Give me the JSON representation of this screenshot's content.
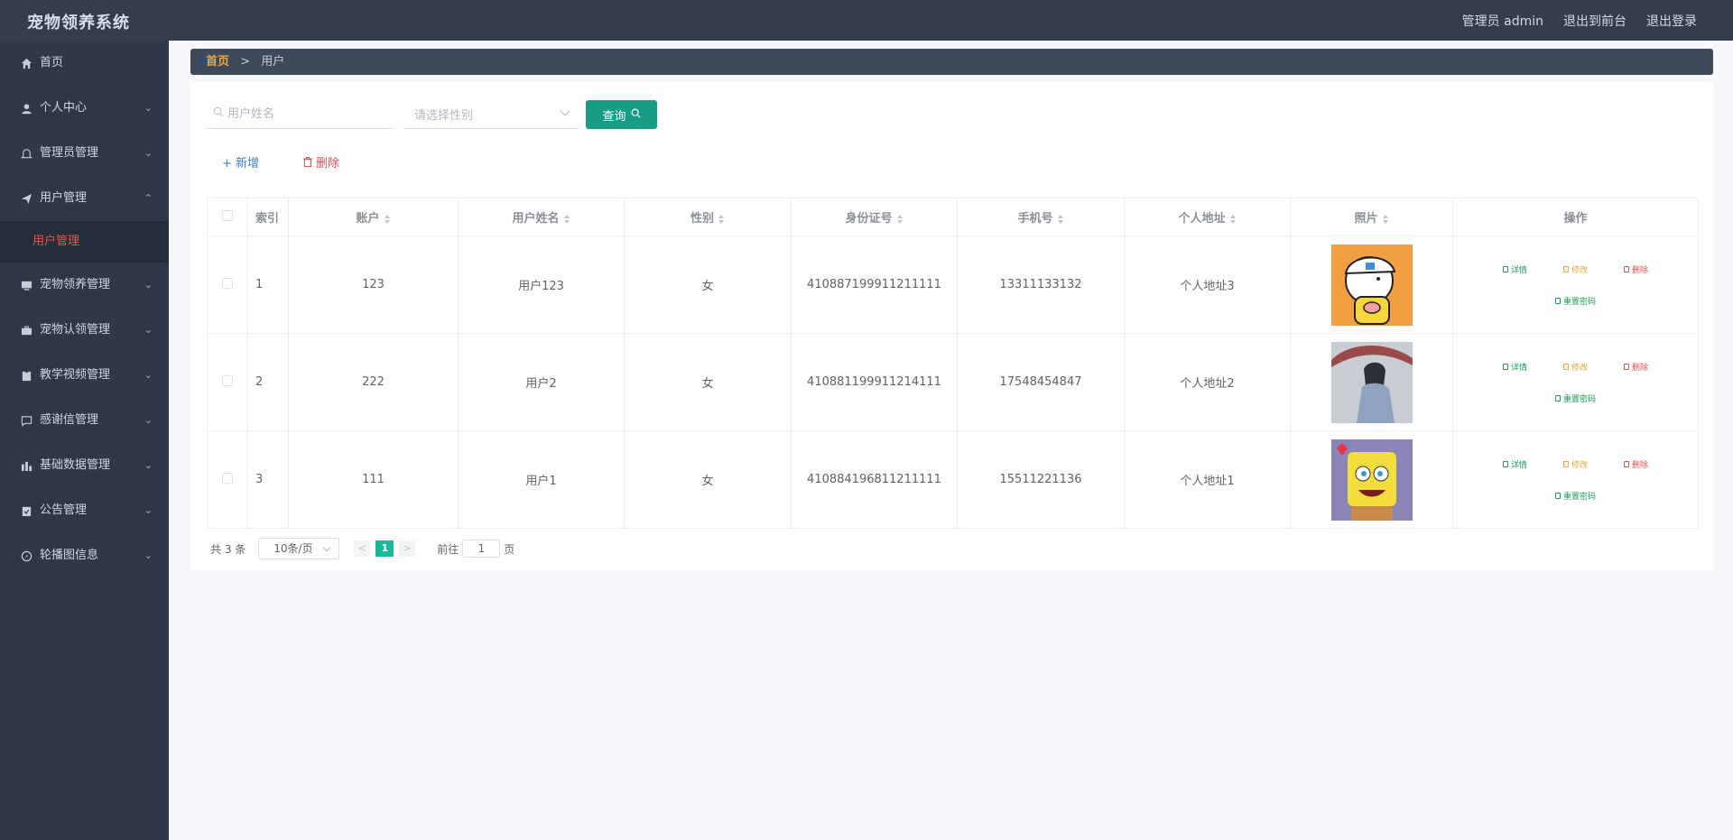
{
  "app": {
    "title": "宠物领养系统",
    "user_label": "管理员 admin",
    "to_front": "退出到前台",
    "logout": "退出登录"
  },
  "sidebar": {
    "items": [
      {
        "label": "首页",
        "icon": "home-icon"
      },
      {
        "label": "个人中心",
        "icon": "user-icon"
      },
      {
        "label": "管理员管理",
        "icon": "bell-icon"
      },
      {
        "label": "用户管理",
        "icon": "send-icon",
        "expanded": true
      },
      {
        "label": "宠物领养管理",
        "icon": "monitor-icon"
      },
      {
        "label": "宠物认领管理",
        "icon": "briefcase-icon"
      },
      {
        "label": "教学视频管理",
        "icon": "clipboard-icon"
      },
      {
        "label": "感谢信管理",
        "icon": "chat-icon"
      },
      {
        "label": "基础数据管理",
        "icon": "chart-icon"
      },
      {
        "label": "公告管理",
        "icon": "notice-icon"
      },
      {
        "label": "轮播图信息",
        "icon": "compass-icon"
      }
    ],
    "sub_item": "用户管理"
  },
  "breadcrumb": {
    "home": "首页",
    "sep": ">",
    "current": "用户"
  },
  "search": {
    "name_placeholder": "用户姓名",
    "gender_placeholder": "请选择性别",
    "query_label": "查询"
  },
  "actions": {
    "add": "新增",
    "delete": "删除"
  },
  "table": {
    "headers": {
      "index": "索引",
      "account": "账户",
      "name": "用户姓名",
      "gender": "性别",
      "id_card": "身份证号",
      "phone": "手机号",
      "address": "个人地址",
      "photo": "照片",
      "ops": "操作"
    },
    "rows": [
      {
        "index": "1",
        "account": "123",
        "name": "用户123",
        "gender": "女",
        "id_card": "410887199911211111",
        "phone": "13311133132",
        "address": "个人地址3"
      },
      {
        "index": "2",
        "account": "222",
        "name": "用户2",
        "gender": "女",
        "id_card": "410881199911214111",
        "phone": "17548454847",
        "address": "个人地址2"
      },
      {
        "index": "3",
        "account": "111",
        "name": "用户1",
        "gender": "女",
        "id_card": "410884196811211111",
        "phone": "15511221136",
        "address": "个人地址1"
      }
    ],
    "op_labels": {
      "detail": "详情",
      "edit": "修改",
      "delete": "删除",
      "reset": "重置密码"
    }
  },
  "pagination": {
    "total": "共 3 条",
    "page_size": "10条/页",
    "prev": "<",
    "current": "1",
    "next": ">",
    "goto_label": "前往",
    "goto_value": "1",
    "page_suffix": "页"
  },
  "colors": {
    "topbar": "#343d4c",
    "sidebar": "#2f3847",
    "accent": "#179d86",
    "active_sub": "#f05252",
    "crumb_home": "#f2a33a"
  }
}
